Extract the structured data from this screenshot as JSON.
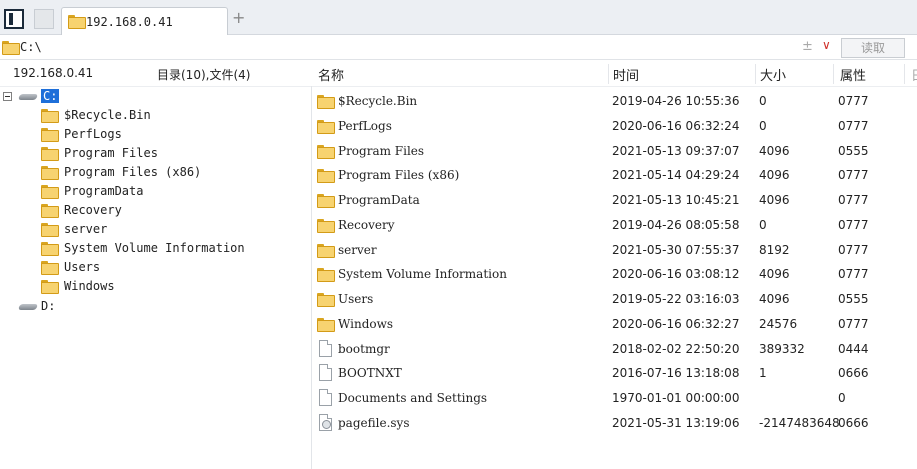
{
  "tabbar": {
    "tab_label": "192.168.0.41",
    "add_symbol": "+"
  },
  "pathbar": {
    "path": "C:\\",
    "sort_symbol": "±",
    "dropdown_symbol": "∨",
    "read_label": "读取"
  },
  "left": {
    "host": "192.168.0.41",
    "summary": "目录(10),文件(4)",
    "drives": [
      {
        "label": "C:",
        "expanded": true,
        "selected": true
      },
      {
        "label": "D:",
        "expanded": false,
        "selected": false
      }
    ],
    "tree": [
      "$Recycle.Bin",
      "PerfLogs",
      "Program Files",
      "Program Files (x86)",
      "ProgramData",
      "Recovery",
      "server",
      "System Volume Information",
      "Users",
      "Windows"
    ]
  },
  "columns": {
    "name": "名称",
    "time": "时间",
    "size": "大小",
    "attr": "属性",
    "extra": "日"
  },
  "files": [
    {
      "name": "$Recycle.Bin",
      "time": "2019-04-26 10:55:36",
      "size": "0",
      "attr": "0777",
      "type": "folder"
    },
    {
      "name": "PerfLogs",
      "time": "2020-06-16 06:32:24",
      "size": "0",
      "attr": "0777",
      "type": "folder"
    },
    {
      "name": "Program Files",
      "time": "2021-05-13 09:37:07",
      "size": "4096",
      "attr": "0555",
      "type": "folder"
    },
    {
      "name": "Program Files (x86)",
      "time": "2021-05-14 04:29:24",
      "size": "4096",
      "attr": "0777",
      "type": "folder"
    },
    {
      "name": "ProgramData",
      "time": "2021-05-13 10:45:21",
      "size": "4096",
      "attr": "0777",
      "type": "folder"
    },
    {
      "name": "Recovery",
      "time": "2019-04-26 08:05:58",
      "size": "0",
      "attr": "0777",
      "type": "folder"
    },
    {
      "name": "server",
      "time": "2021-05-30 07:55:37",
      "size": "8192",
      "attr": "0777",
      "type": "folder"
    },
    {
      "name": "System Volume Information",
      "time": "2020-06-16 03:08:12",
      "size": "4096",
      "attr": "0777",
      "type": "folder"
    },
    {
      "name": "Users",
      "time": "2019-05-22 03:16:03",
      "size": "4096",
      "attr": "0555",
      "type": "folder"
    },
    {
      "name": "Windows",
      "time": "2020-06-16 06:32:27",
      "size": "24576",
      "attr": "0777",
      "type": "folder"
    },
    {
      "name": "bootmgr",
      "time": "2018-02-02 22:50:20",
      "size": "389332",
      "attr": "0444",
      "type": "file"
    },
    {
      "name": "BOOTNXT",
      "time": "2016-07-16 13:18:08",
      "size": "1",
      "attr": "0666",
      "type": "file"
    },
    {
      "name": "Documents and Settings",
      "time": "1970-01-01 00:00:00",
      "size": "",
      "attr": "0",
      "type": "file"
    },
    {
      "name": "pagefile.sys",
      "time": "2021-05-31 13:19:06",
      "size": "-2147483648",
      "attr": "0666",
      "type": "sysfile"
    }
  ]
}
